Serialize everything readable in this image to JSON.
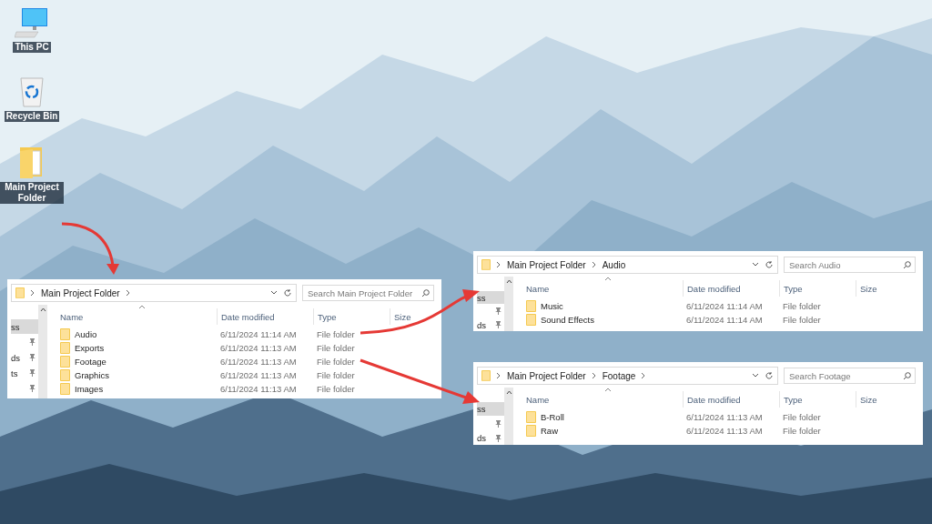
{
  "desktop_icons": [
    {
      "kind": "pc",
      "label": "This PC"
    },
    {
      "kind": "bin",
      "label": "Recycle Bin"
    },
    {
      "kind": "folder",
      "label": "Main Project Folder"
    }
  ],
  "windows": [
    {
      "breadcrumb": [
        "Main Project Folder"
      ],
      "trailing_chevron": true,
      "search": {
        "placeholder": "Search Main Project Folder"
      },
      "columns": [
        "Name",
        "Date modified",
        "Type",
        "Size"
      ],
      "nav_items": [
        {
          "text": "ss",
          "pinned": false,
          "selected": true
        },
        {
          "pinned": true,
          "selected": false
        },
        {
          "text": "ds",
          "pinned": true,
          "selected": false
        },
        {
          "text": "ts",
          "pinned": true,
          "selected": false
        },
        {
          "pinned": true,
          "selected": false
        }
      ],
      "rows": [
        {
          "name": "Audio",
          "date": "6/11/2024 11:14 AM",
          "type": "File folder"
        },
        {
          "name": "Exports",
          "date": "6/11/2024 11:13 AM",
          "type": "File folder"
        },
        {
          "name": "Footage",
          "date": "6/11/2024 11:13 AM",
          "type": "File folder"
        },
        {
          "name": "Graphics",
          "date": "6/11/2024 11:13 AM",
          "type": "File folder"
        },
        {
          "name": "Images",
          "date": "6/11/2024 11:13 AM",
          "type": "File folder"
        }
      ]
    },
    {
      "breadcrumb": [
        "Main Project Folder",
        "Audio"
      ],
      "trailing_chevron": false,
      "search": {
        "placeholder": "Search Audio"
      },
      "columns": [
        "Name",
        "Date modified",
        "Type",
        "Size"
      ],
      "nav_items": [
        {
          "text": "ss",
          "pinned": false,
          "selected": true
        },
        {
          "pinned": true,
          "selected": false
        },
        {
          "text": "ds",
          "pinned": true,
          "selected": false
        }
      ],
      "rows": [
        {
          "name": "Music",
          "date": "6/11/2024 11:14 AM",
          "type": "File folder"
        },
        {
          "name": "Sound Effects",
          "date": "6/11/2024 11:14 AM",
          "type": "File folder"
        }
      ]
    },
    {
      "breadcrumb": [
        "Main Project Folder",
        "Footage"
      ],
      "trailing_chevron": true,
      "search": {
        "placeholder": "Search Footage"
      },
      "columns": [
        "Name",
        "Date modified",
        "Type",
        "Size"
      ],
      "nav_items": [
        {
          "text": "ss",
          "pinned": false,
          "selected": true
        },
        {
          "pinned": true,
          "selected": false
        },
        {
          "text": "ds",
          "pinned": true,
          "selected": false
        }
      ],
      "rows": [
        {
          "name": "B-Roll",
          "date": "6/11/2024 11:13 AM",
          "type": "File folder"
        },
        {
          "name": "Raw",
          "date": "6/11/2024 11:13 AM",
          "type": "File folder"
        }
      ]
    }
  ]
}
